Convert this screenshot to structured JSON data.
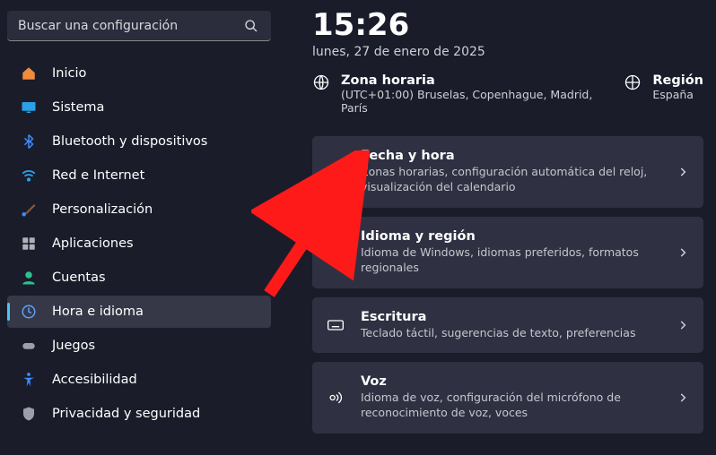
{
  "search": {
    "placeholder": "Buscar una configuración"
  },
  "sidebar": {
    "items": [
      {
        "label": "Inicio"
      },
      {
        "label": "Sistema"
      },
      {
        "label": "Bluetooth y dispositivos"
      },
      {
        "label": "Red e Internet"
      },
      {
        "label": "Personalización"
      },
      {
        "label": "Aplicaciones"
      },
      {
        "label": "Cuentas"
      },
      {
        "label": "Hora e idioma"
      },
      {
        "label": "Juegos"
      },
      {
        "label": "Accesibilidad"
      },
      {
        "label": "Privacidad y seguridad"
      }
    ]
  },
  "clock": {
    "time": "15:26",
    "date": "lunes, 27 de enero de 2025"
  },
  "timezone": {
    "title": "Zona horaria",
    "value": "(UTC+01:00) Bruselas, Copenhague, Madrid, París"
  },
  "region": {
    "title": "Región",
    "value": "España"
  },
  "cards": [
    {
      "title": "Fecha y hora",
      "sub": "Zonas horarias, configuración automática del reloj, visualización del calendario"
    },
    {
      "title": "Idioma y región",
      "sub": "Idioma de Windows, idiomas preferidos, formatos regionales"
    },
    {
      "title": "Escritura",
      "sub": "Teclado táctil, sugerencias de texto, preferencias"
    },
    {
      "title": "Voz",
      "sub": "Idioma de voz, configuración del micrófono de reconocimiento de voz, voces"
    }
  ]
}
